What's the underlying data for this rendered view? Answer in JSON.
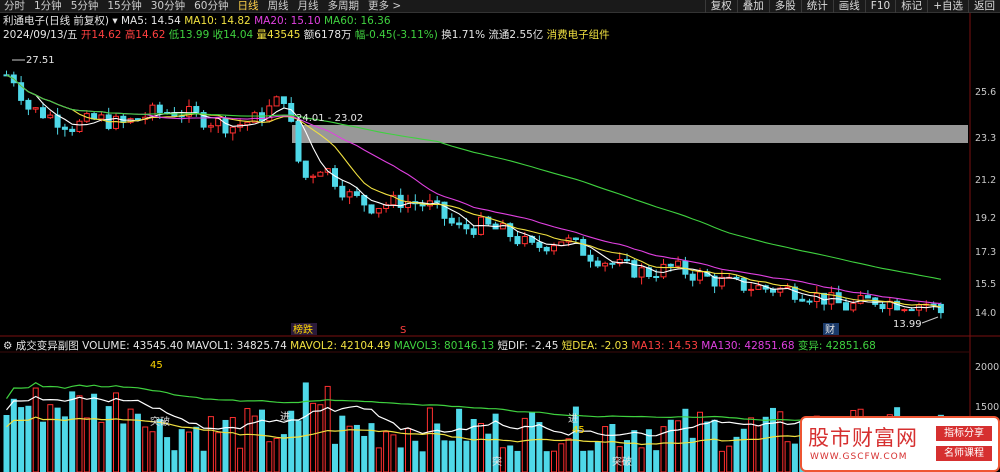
{
  "toolbar": {
    "periods": [
      "分时",
      "1分钟",
      "5分钟",
      "15分钟",
      "30分钟",
      "60分钟",
      "日线",
      "周线",
      "月线",
      "多周期",
      "更多 >"
    ],
    "active_period": "日线",
    "right_buttons": [
      "复权",
      "叠加",
      "多股",
      "统计",
      "画线",
      "F10",
      "标记",
      "+自选",
      "返回"
    ]
  },
  "header": {
    "stock_title": "利通电子(日线 前复权)",
    "ma5": "MA5: 14.54",
    "ma10": "MA10: 14.82",
    "ma20": "MA20: 15.10",
    "ma60": "MA60: 16.36",
    "date": "2024/09/13/五",
    "open": "开14.62",
    "high": "高14.62",
    "low": "低13.99",
    "close": "收14.04",
    "volume": "量43545",
    "amount": "额6178万",
    "change": "幅-0.45(-3.11%)",
    "turnover": "换1.71%",
    "float": "流通2.55亿",
    "concept": "消费电子组件"
  },
  "price_axis": [
    "25.6",
    "23.3",
    "21.2",
    "19.2",
    "17.3",
    "15.5",
    "14.0"
  ],
  "annotations": {
    "high_label": "27.51",
    "low_label": "13.99",
    "gap_label": "24.01 - 23.02",
    "tag_list": "榜跌",
    "tag_s": "S",
    "tag_cai": "财"
  },
  "sub_chart": {
    "name": "成交变异副图",
    "volume": "VOLUME: 43545.40",
    "mavol1": "MAVOL1: 34825.74",
    "mavol2": "MAVOL2: 42104.49",
    "mavol3": "MAVOL3: 80146.13",
    "dif": "短DIF: -2.45",
    "dea": "短DEA: -2.03",
    "ma13": "MA13: 14.53",
    "ma130": "MA130: 42851.68",
    "bianyi": "变异: 42851.68",
    "axis": [
      "2000",
      "1500"
    ],
    "label_45": "45",
    "label_tupo": "突破",
    "label_jin": "进",
    "label_tu": "突",
    "label_tuxie": "突破"
  },
  "watermark": {
    "title": "股市财富网",
    "url": "WWW.GSCFW.COM",
    "tag1": "指标分享",
    "tag2": "名师课程"
  },
  "colors": {
    "up": "#ff3030",
    "down": "#4fd8e8",
    "ma5": "#ffffff",
    "ma10": "#f0e040",
    "ma20": "#e040e0",
    "ma60": "#3fd13f",
    "gap_band": "#aaaaaa"
  }
}
